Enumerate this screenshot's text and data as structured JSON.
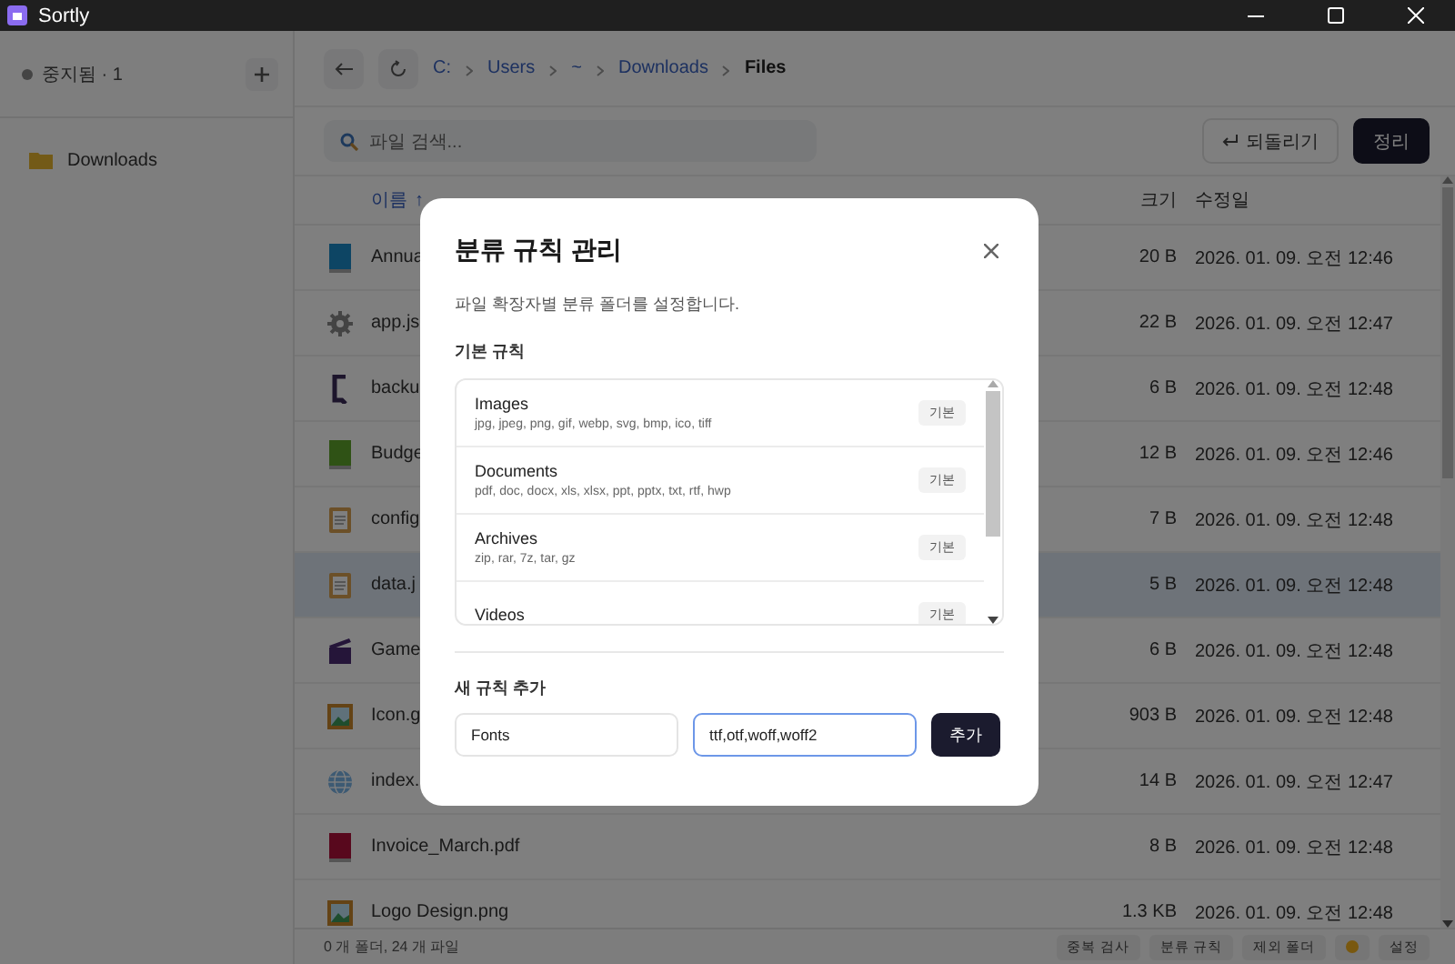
{
  "window": {
    "title": "Sortly"
  },
  "sidebar": {
    "status": "중지됨 · 1",
    "items": [
      {
        "label": "Downloads",
        "selected": false
      }
    ]
  },
  "breadcrumb": [
    "C:",
    "Users",
    "~",
    "Downloads",
    "Files"
  ],
  "search": {
    "placeholder": "파일 검색..."
  },
  "actions": [
    {
      "label": "되돌리기",
      "kind": "outline"
    },
    {
      "label": "정리",
      "kind": "primary"
    }
  ],
  "table": {
    "columns": [
      {
        "label": "이름",
        "sort": "↑"
      },
      {
        "label": "크기"
      },
      {
        "label": "수정일"
      }
    ],
    "rows": [
      {
        "name": "Annua",
        "size": "20 B",
        "modified": "2026. 01. 09. 오전 12:46",
        "kind": "report",
        "selected": false
      },
      {
        "name": "app.js",
        "size": "22 B",
        "modified": "2026. 01. 09. 오전 12:47",
        "kind": "gear",
        "selected": false
      },
      {
        "name": "backu",
        "size": "6 B",
        "modified": "2026. 01. 09. 오전 12:48",
        "kind": "shortcut",
        "selected": false
      },
      {
        "name": "Budge",
        "size": "12 B",
        "modified": "2026. 01. 09. 오전 12:46",
        "kind": "spreadsheet",
        "selected": false
      },
      {
        "name": "config",
        "size": "7 B",
        "modified": "2026. 01. 09. 오전 12:48",
        "kind": "clipboard",
        "selected": false
      },
      {
        "name": "data.j",
        "size": "5 B",
        "modified": "2026. 01. 09. 오전 12:48",
        "kind": "clipboard",
        "selected": true
      },
      {
        "name": "Game",
        "size": "6 B",
        "modified": "2026. 01. 09. 오전 12:48",
        "kind": "clapper",
        "selected": false
      },
      {
        "name": "Icon.g",
        "size": "903 B",
        "modified": "2026. 01. 09. 오전 12:48",
        "kind": "image",
        "selected": false
      },
      {
        "name": "index.",
        "size": "14 B",
        "modified": "2026. 01. 09. 오전 12:47",
        "kind": "globe",
        "selected": false
      },
      {
        "name": "Invoice_March.pdf",
        "size": "8 B",
        "modified": "2026. 01. 09. 오전 12:48",
        "kind": "pdf",
        "selected": false
      },
      {
        "name": "Logo Design.png",
        "size": "1.3 KB",
        "modified": "2026. 01. 09. 오전 12:48",
        "kind": "image",
        "selected": false
      }
    ]
  },
  "status_bar": {
    "summary": "0 개 폴더, 24 개 파일",
    "buttons": [
      "중복 검사",
      "분류 규칙",
      "제외 폴더"
    ],
    "settings": "설정"
  },
  "dialog": {
    "title": "분류 규칙 관리",
    "description": "파일 확장자별 분류 폴더를 설정합니다.",
    "rules_heading": "기본 규칙",
    "rules": [
      {
        "name": "Images",
        "extensions": "jpg, jpeg, png, gif, webp, svg, bmp, ico, tiff",
        "badge": "기본"
      },
      {
        "name": "Documents",
        "extensions": "pdf, doc, docx, xls, xlsx, ppt, pptx, txt, rtf, hwp",
        "badge": "기본"
      },
      {
        "name": "Archives",
        "extensions": "zip, rar, 7z, tar, gz",
        "badge": "기본"
      },
      {
        "name": "Videos",
        "badge": "기본"
      }
    ],
    "new_heading": "새 규칙 추가",
    "fields": [
      {
        "value": "Fonts",
        "focused": false
      },
      {
        "value": "ttf,otf,woff,woff2",
        "focused": true
      }
    ],
    "add_button": "추가"
  }
}
